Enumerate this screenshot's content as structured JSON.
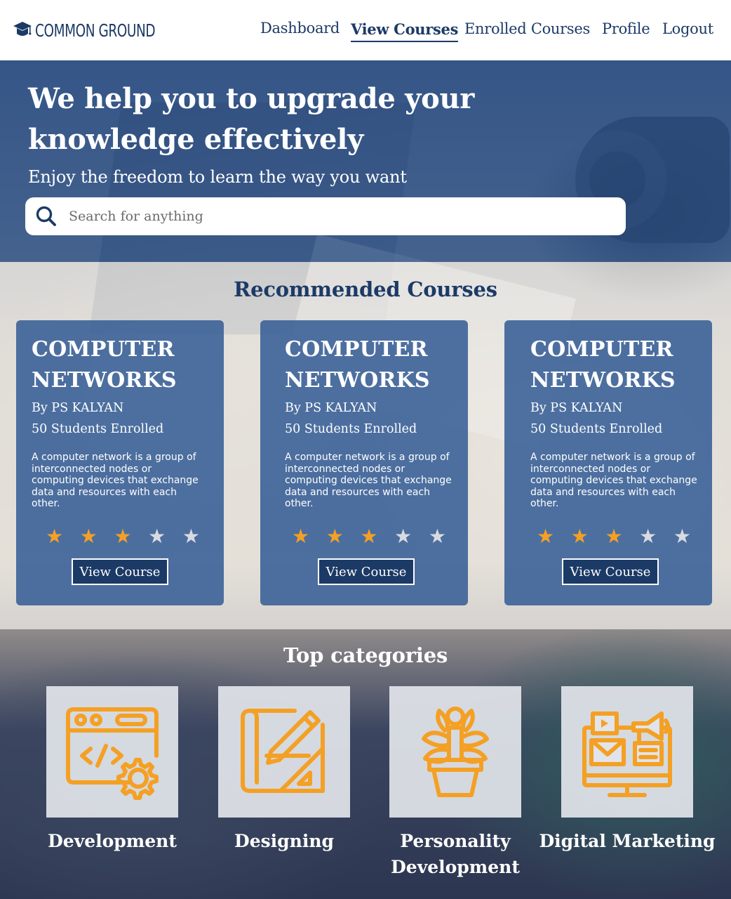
{
  "brand": {
    "name": "COMMON GROUND"
  },
  "nav": {
    "items": [
      {
        "label": "Dashboard",
        "active": false
      },
      {
        "label": "View Courses",
        "active": true
      },
      {
        "label": "Enrolled Courses",
        "active": false
      },
      {
        "label": "Profile",
        "active": false
      },
      {
        "label": "Logout",
        "active": false
      }
    ]
  },
  "hero": {
    "title": "We help you to upgrade your knowledge effectively",
    "subtitle": "Enjoy the freedom to learn the way you want",
    "search": {
      "placeholder": "Search for anything",
      "value": ""
    }
  },
  "recommended": {
    "title": "Recommended Courses",
    "courses": [
      {
        "title": "COMPUTER NETWORKS",
        "author": "By PS KALYAN",
        "enrolled": "50 Students Enrolled",
        "description": "A computer network is a group of interconnected nodes or computing devices that exchange data and resources with each other.",
        "rating": 3,
        "max_rating": 5,
        "button": "View Course"
      },
      {
        "title": "COMPUTER NETWORKS",
        "author": "By PS KALYAN",
        "enrolled": "50 Students Enrolled",
        "description": "A computer network is a group of interconnected nodes or computing devices that exchange data and resources with each other.",
        "rating": 3,
        "max_rating": 5,
        "button": "View Course"
      },
      {
        "title": "COMPUTER NETWORKS",
        "author": "By PS KALYAN",
        "enrolled": "50 Students Enrolled",
        "description": "A computer network is a group of interconnected nodes or computing devices that exchange data and resources with each other.",
        "rating": 3,
        "max_rating": 5,
        "button": "View Course"
      }
    ]
  },
  "categories": {
    "title": "Top categories",
    "items": [
      {
        "label": "Development",
        "icon": "code-settings-icon"
      },
      {
        "label": "Designing",
        "icon": "blueprint-pencil-icon"
      },
      {
        "label": "Personality Development",
        "icon": "person-plant-icon"
      },
      {
        "label": "Digital Marketing",
        "icon": "digital-marketing-icon"
      }
    ]
  },
  "colors": {
    "primary": "#1c3a66",
    "hero_overlay": "#2e538a",
    "card": "#375f96",
    "star_on": "#f4a024",
    "star_off": "#d9dbe0",
    "category_icon": "#f4a024"
  }
}
